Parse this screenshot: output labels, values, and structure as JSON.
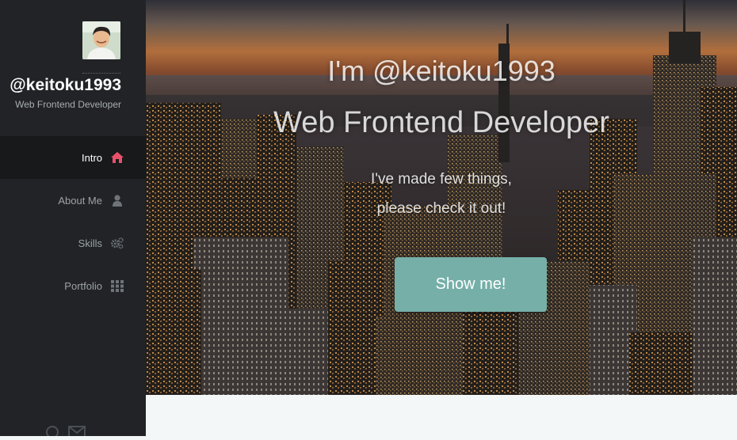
{
  "profile": {
    "avatar_icon": "avatar-photo",
    "username": "@keitoku1993",
    "role": "Web Frontend Developer"
  },
  "nav": {
    "items": [
      {
        "label": "Intro",
        "icon": "home-icon",
        "active": true
      },
      {
        "label": "About Me",
        "icon": "user-icon",
        "active": false
      },
      {
        "label": "Skills",
        "icon": "gears-icon",
        "active": false
      },
      {
        "label": "Portfolio",
        "icon": "grid-icon",
        "active": false
      }
    ]
  },
  "social": {
    "icons": [
      "github-icon",
      "mail-icon"
    ]
  },
  "hero": {
    "title": "I'm @keitoku1993",
    "subtitle": "Web Frontend Developer",
    "text_line1": "I've made few things,",
    "text_line2": "please check it out!",
    "cta_label": "Show me!"
  },
  "colors": {
    "sidebar_bg": "#212326",
    "active_nav_bg": "#17191b",
    "accent_icon": "#e8506a",
    "cta_bg": "#75afa8",
    "page_bg": "#f4f7f7"
  }
}
